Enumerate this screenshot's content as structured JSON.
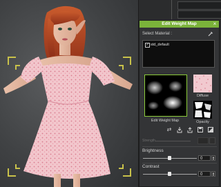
{
  "dialog": {
    "title": "Edit Weight Map",
    "select_material_label": "Select Material :",
    "materials": [
      {
        "name": "std_default",
        "checked": true
      }
    ],
    "weight_map_label": "Edit Weight Map",
    "diffuse_label": "Diffuse",
    "opacity_label": "Opacity",
    "strength_label": "Strength",
    "brightness": {
      "label": "Brightness",
      "value": "0"
    },
    "contrast": {
      "label": "Contrast",
      "value": "0"
    },
    "toolbar_icons": [
      "swap-icon",
      "load-icon",
      "export-icon",
      "save-icon",
      "invert-icon"
    ]
  },
  "colors": {
    "title_bar": "#7bb33a",
    "dialog_bg": "#333436",
    "dress": "#f2c6cc",
    "hair": "#b8441f",
    "viewport_corners": "#c9c24a"
  }
}
